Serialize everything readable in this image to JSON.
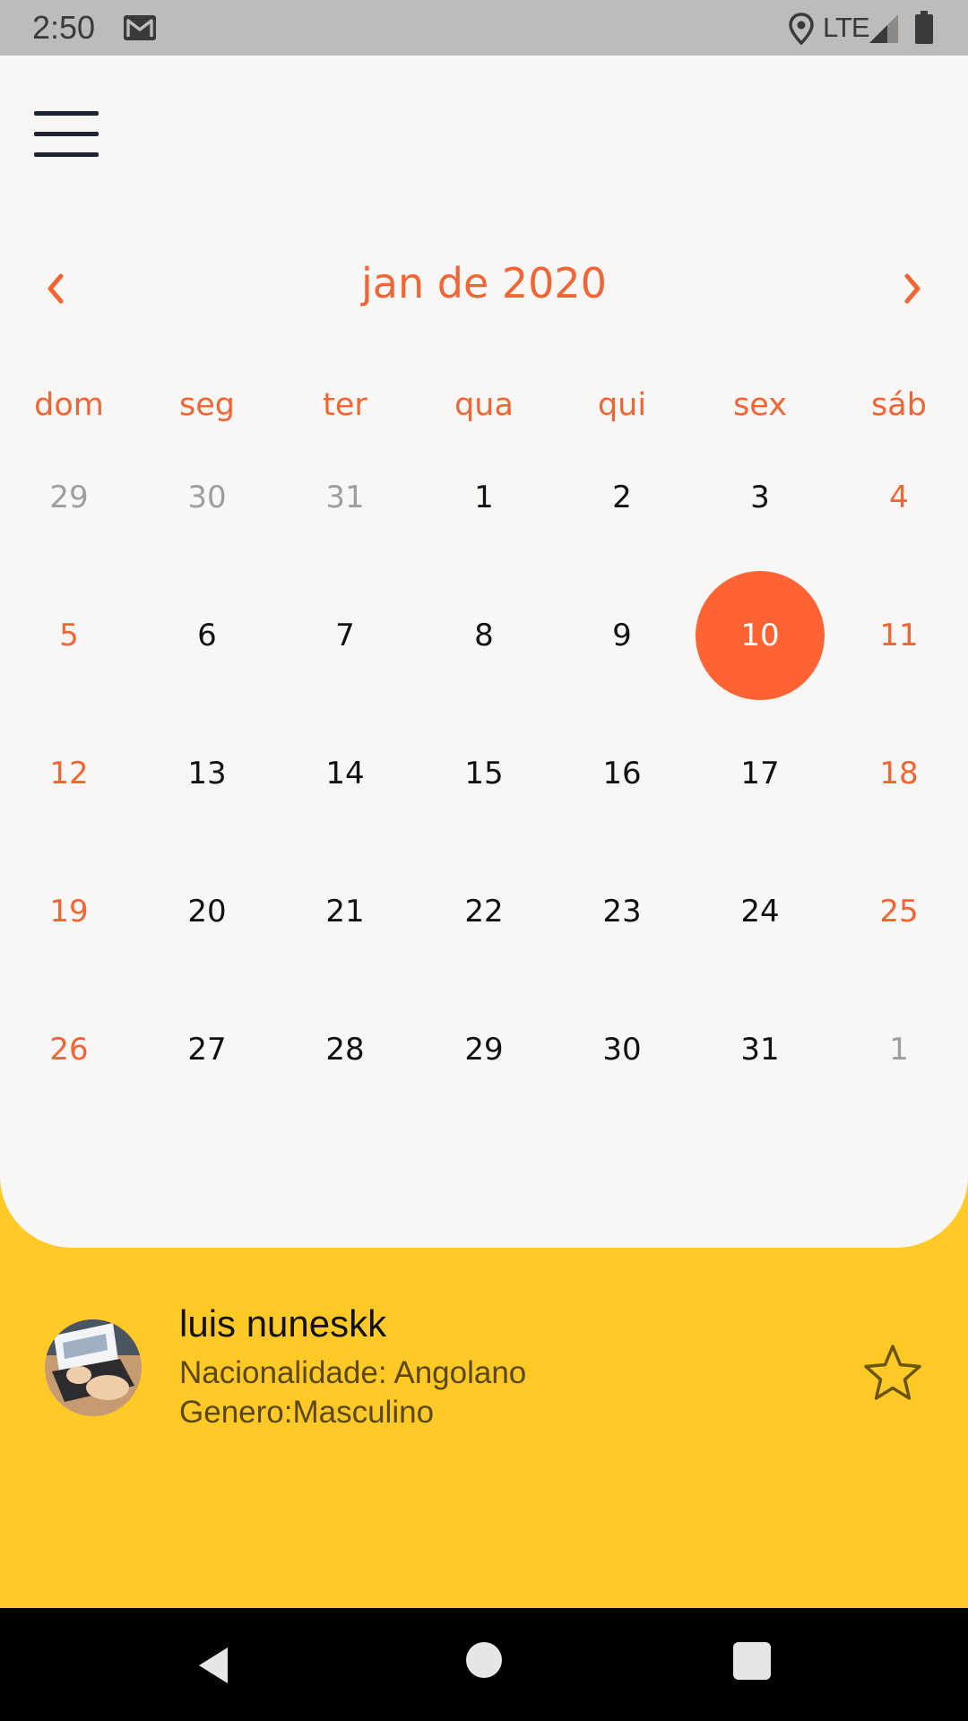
{
  "status_bar": {
    "time": "2:50",
    "network": "LTE"
  },
  "calendar": {
    "month_title": "jan de 2020",
    "weekdays": [
      "dom",
      "seg",
      "ter",
      "qua",
      "qui",
      "sex",
      "sáb"
    ],
    "weeks": [
      [
        "29",
        "30",
        "31",
        "1",
        "2",
        "3",
        "4"
      ],
      [
        "5",
        "6",
        "7",
        "8",
        "9",
        "10",
        "11"
      ],
      [
        "12",
        "13",
        "14",
        "15",
        "16",
        "17",
        "18"
      ],
      [
        "19",
        "20",
        "21",
        "22",
        "23",
        "24",
        "25"
      ],
      [
        "26",
        "27",
        "28",
        "29",
        "30",
        "31",
        "1"
      ]
    ],
    "outside_month": [
      [
        0,
        0
      ],
      [
        0,
        1
      ],
      [
        0,
        2
      ],
      [
        4,
        6
      ]
    ],
    "selected": [
      1,
      5
    ]
  },
  "profile": {
    "name": "luis nuneskk",
    "nationality": "Nacionalidade: Angolano",
    "gender": "Genero:Masculino"
  },
  "colors": {
    "accent": "#f26433",
    "selected_day": "#ff6333",
    "card_background": "#f9f7f6",
    "panel_background": "#ffca28"
  },
  "icons": {
    "menu": "hamburger-icon",
    "prev": "chevron-left-icon",
    "next": "chevron-right-icon",
    "favorite": "star-outline-icon"
  }
}
